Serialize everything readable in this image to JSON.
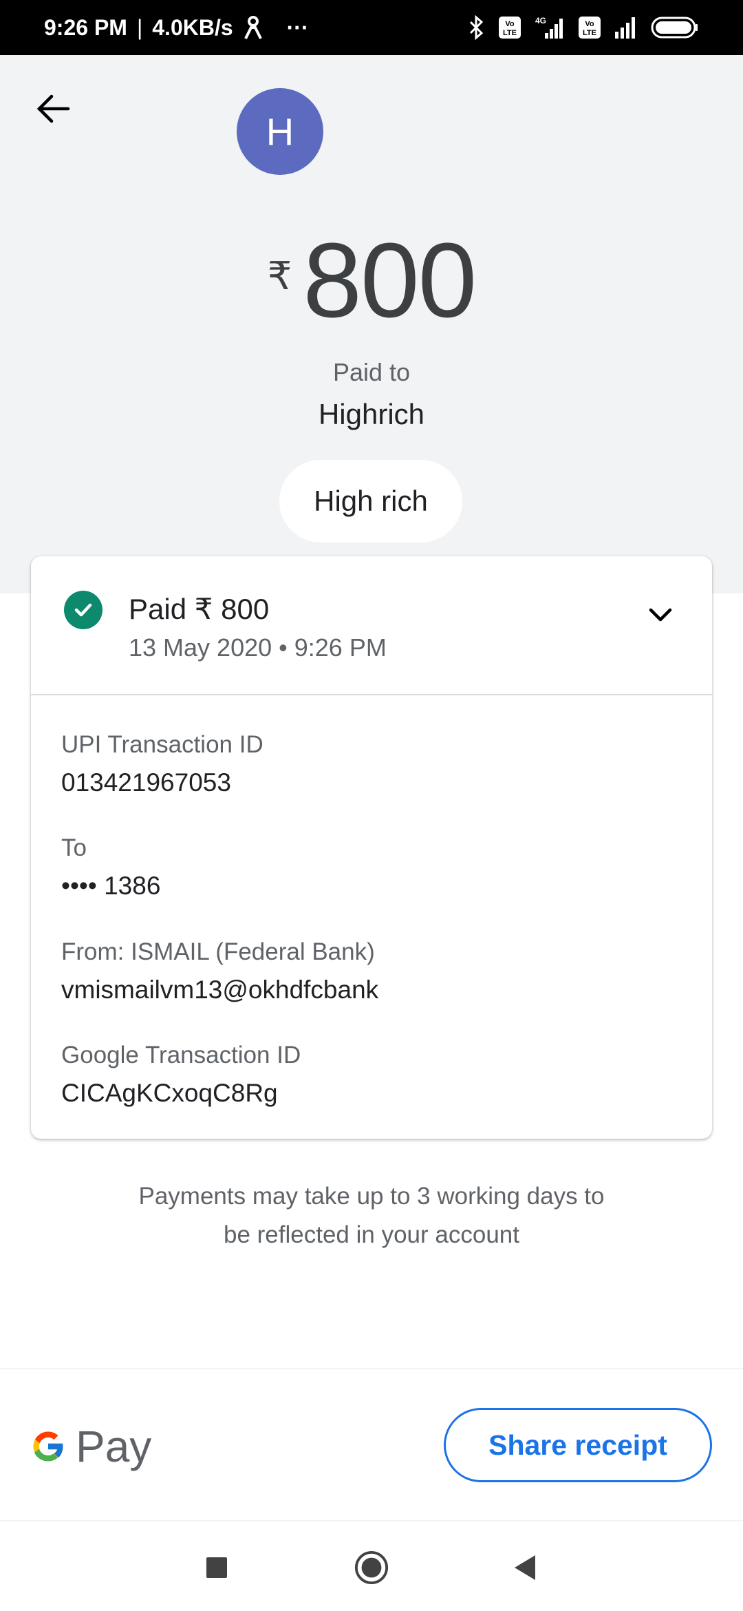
{
  "status_bar": {
    "time": "9:26 PM",
    "network_speed": "4.0KB/s",
    "dots": "···",
    "icons": [
      "person-icon",
      "bluetooth-icon",
      "volte-icon",
      "signal-4g-icon",
      "volte-icon",
      "signal-icon",
      "battery-icon"
    ],
    "volte_label": "Vo LTE",
    "network_type": "4G"
  },
  "header": {
    "back_icon": "arrow-back-icon",
    "avatar_letter": "H",
    "avatar_color": "#5c6bc0",
    "currency_symbol": "₹",
    "amount": "800",
    "paid_to_label": "Paid to",
    "payee_name": "Highrich",
    "note": "High rich"
  },
  "card": {
    "status_icon": "check-circle-icon",
    "status_color": "#0d8a6e",
    "title": "Paid ₹ 800",
    "date_time": "13 May 2020 • 9:26 PM",
    "expand_icon": "chevron-down-icon",
    "details": [
      {
        "label": "UPI Transaction ID",
        "value": "013421967053"
      },
      {
        "label": "To",
        "value": "•••• 1386"
      },
      {
        "label": "From: ISMAIL (Federal Bank)",
        "value": "vmismailvm13@okhdfcbank"
      },
      {
        "label": "Google Transaction ID",
        "value": "CICAgKCxoqC8Rg"
      }
    ]
  },
  "notice": {
    "line1": "Payments may take up to 3 working days to",
    "line2": "be reflected in your account"
  },
  "footer": {
    "logo_letter": "G",
    "logo_text": "Pay",
    "share_button": "Share receipt",
    "accent_color": "#1a73e8"
  },
  "nav": {
    "items": [
      "recents-square-icon",
      "home-circle-icon",
      "back-triangle-icon"
    ]
  }
}
